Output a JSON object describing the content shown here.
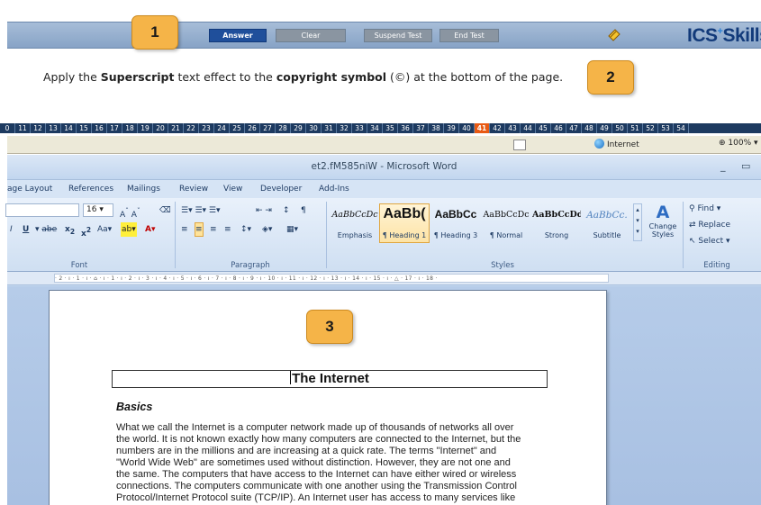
{
  "test_toolbar": {
    "answer_label": "Answer",
    "clear_label": "Clear",
    "suspend_label": "Suspend Test",
    "end_label": "End Test",
    "logo_text": "ICS",
    "logo_plus": "+",
    "logo_suffix": "Skills"
  },
  "callouts": [
    "1",
    "2",
    "3"
  ],
  "task": {
    "part1": "Apply the ",
    "bold1": "Superscript",
    "part2": " text effect to the ",
    "bold2": "copyright symbol",
    "part3": " (©) at the bottom of the page."
  },
  "question_strip": {
    "items": [
      "0",
      "11",
      "12",
      "13",
      "14",
      "15",
      "16",
      "17",
      "18",
      "19",
      "20",
      "21",
      "22",
      "23",
      "24",
      "25",
      "26",
      "27",
      "28",
      "29",
      "30",
      "31",
      "32",
      "33",
      "34",
      "35",
      "36",
      "37",
      "38",
      "39",
      "40",
      "41",
      "42",
      "43",
      "44",
      "45",
      "46",
      "47",
      "48",
      "49",
      "50",
      "51",
      "52",
      "53",
      "54"
    ],
    "active": "41"
  },
  "ie_status": {
    "zone": "Internet",
    "zoom": "100%"
  },
  "word": {
    "title": "et2.fM585niW - Microsoft Word",
    "tabs": [
      "age Layout",
      "References",
      "Mailings",
      "Review",
      "View",
      "Developer",
      "Add-Ins"
    ],
    "font_size": "16",
    "groups": {
      "font": "Font",
      "paragraph": "Paragraph",
      "styles": "Styles",
      "editing": "Editing"
    },
    "styles": [
      {
        "sample": "AaBbCcDc",
        "label": "Emphasis"
      },
      {
        "sample": "AaBb(",
        "label": "¶ Heading 1"
      },
      {
        "sample": "AaBbCc",
        "label": "¶ Heading 3"
      },
      {
        "sample": "AaBbCcDc",
        "label": "¶ Normal"
      },
      {
        "sample": "AaBbCcDd",
        "label": "Strong"
      },
      {
        "sample": "AaBbCc.",
        "label": "Subtitle"
      }
    ],
    "change_styles": "Change Styles",
    "editing": {
      "find": "Find",
      "replace": "Replace",
      "select": "Select"
    },
    "ruler_text": "· 2 · ı · 1 · ı · ⌂ · ı · 1 · ı · 2 · ı · 3 · ı · 4 · ı · 5 · ı · 6 · ı · 7 · ı · 8 · ı · 9 · ı · 10 · ı · 11 · ı · 12 · ı · 13 · ı · 14 · ı · 15 · ı · △ · 17 · ı · 18 ·"
  },
  "document": {
    "title": "The Internet",
    "heading": "Basics",
    "lines": [
      "What we call the Internet is a computer network made up of thousands of networks all over",
      "the world. It is not known exactly how many computers are connected to the Internet, but the",
      "numbers are in the millions and are increasing at a quick rate. The terms \"Internet\" and",
      "\"World Wide Web\" are sometimes used without distinction. However, they are not one and",
      "the same. The computers that have access to the Internet can have either wired or wireless",
      "connections. The computers communicate with one another using the Transmission Control",
      "Protocol/Internet Protocol suite (TCP/IP). An Internet user has access to many services like"
    ]
  },
  "colors": {
    "answer_button": "#1f4f9b",
    "callout": "#f5b448",
    "active_question": "#e85a14",
    "question_strip": "#1d3a60"
  }
}
